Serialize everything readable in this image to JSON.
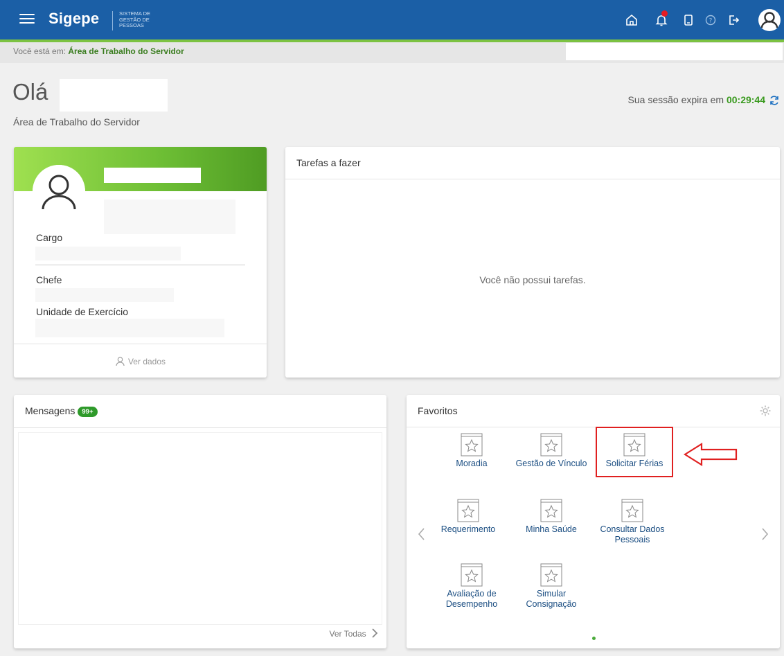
{
  "header": {
    "brand": "Sigepe",
    "brand_sub": "Sistema de Gestão de Pessoas"
  },
  "breadcrumb": {
    "prefix": "Você está em:",
    "current": "Área de Trabalho do Servidor"
  },
  "page": {
    "greeting": "Olá",
    "subtitle": "Área de Trabalho do Servidor",
    "session_label": "Sua sessão expira em",
    "session_time": "00:29:44"
  },
  "profile": {
    "cargo_label": "Cargo",
    "chefe_label": "Chefe",
    "unidade_label": "Unidade de Exercício",
    "view_label": "Ver dados"
  },
  "tasks": {
    "title": "Tarefas a fazer",
    "empty": "Você não possui tarefas."
  },
  "messages": {
    "title": "Mensagens",
    "badge": "99+",
    "see_all": "Ver Todas"
  },
  "favorites": {
    "title": "Favoritos",
    "items": [
      {
        "label": "Moradia"
      },
      {
        "label": "Gestão de Vínculo"
      },
      {
        "label": "Solicitar Férias"
      },
      {
        "label": "Requerimento"
      },
      {
        "label": "Minha Saúde"
      },
      {
        "label": "Consultar Dados Pessoais"
      },
      {
        "label": "Avaliação de Desempenho"
      },
      {
        "label": "Simular Consignação"
      }
    ]
  },
  "colors": {
    "topbar": "#1b5fa6",
    "accent_green": "#7cc242",
    "highlight_red": "#e02020"
  }
}
